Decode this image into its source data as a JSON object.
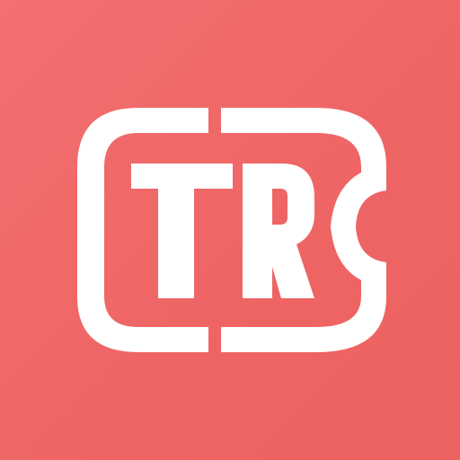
{
  "app_icon": {
    "monogram": "TR",
    "colors": {
      "background": "#ef6866",
      "background_light": "#f27070",
      "foreground": "#ffffff"
    },
    "icons": [
      "ticket-icon"
    ]
  }
}
